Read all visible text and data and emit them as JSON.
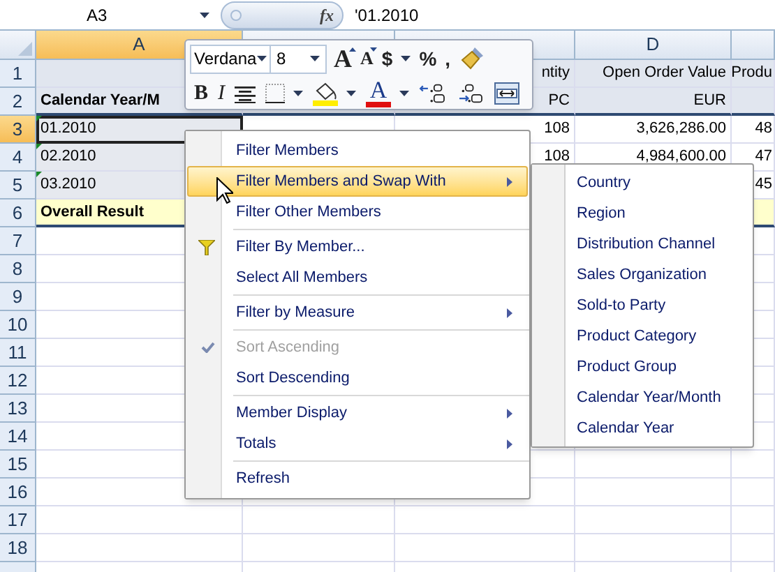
{
  "formula_bar": {
    "cell_ref": "A3",
    "function_label": "fx",
    "formula": "'01.2010"
  },
  "columns": [
    {
      "label": "A",
      "selected": true
    },
    {
      "selected": false
    },
    {
      "selected": false
    },
    {
      "label": "D",
      "selected": false
    },
    {
      "selected": false
    }
  ],
  "rows": [
    {
      "number": "1",
      "kind": "header",
      "selected": false,
      "cells": [
        null,
        null,
        "ntity",
        "Open Order Value",
        "Produ"
      ]
    },
    {
      "number": "2",
      "kind": "header",
      "selected": false,
      "cells": [
        "Calendar Year/M",
        null,
        "PC",
        "EUR",
        null
      ]
    },
    {
      "number": "3",
      "kind": "data",
      "selected": true,
      "cells": [
        "01.2010",
        null,
        "108",
        "3,626,286.00",
        "48"
      ]
    },
    {
      "number": "4",
      "kind": "data",
      "selected": false,
      "cells": [
        "02.2010",
        null,
        "108",
        "4,984,600.00",
        "47"
      ]
    },
    {
      "number": "5",
      "kind": "data",
      "selected": false,
      "cells": [
        "03.2010",
        null,
        null,
        null,
        "45"
      ]
    },
    {
      "number": "6",
      "kind": "total",
      "selected": false,
      "cells": [
        "Overall Result",
        null,
        null,
        null,
        null
      ]
    },
    {
      "number": "7",
      "kind": "empty",
      "selected": false
    },
    {
      "number": "8",
      "kind": "empty",
      "selected": false
    },
    {
      "number": "9",
      "kind": "empty",
      "selected": false
    },
    {
      "number": "10",
      "kind": "empty",
      "selected": false
    },
    {
      "number": "11",
      "kind": "empty",
      "selected": false
    },
    {
      "number": "12",
      "kind": "empty",
      "selected": false
    },
    {
      "number": "13",
      "kind": "empty",
      "selected": false
    },
    {
      "number": "14",
      "kind": "empty",
      "selected": false
    },
    {
      "number": "15",
      "kind": "empty",
      "selected": false
    },
    {
      "number": "16",
      "kind": "empty",
      "selected": false
    },
    {
      "number": "17",
      "kind": "empty",
      "selected": false
    },
    {
      "number": "18",
      "kind": "empty",
      "selected": false
    }
  ],
  "mini_toolbar": {
    "font": "Verdana",
    "size": "8",
    "row_1": [
      {
        "kind": "grow",
        "label": "A"
      },
      {
        "kind": "shrink",
        "label": "A"
      },
      {
        "kind": "currency",
        "label": "$"
      },
      {
        "kind": "percent",
        "label": "%"
      },
      {
        "kind": "comma",
        "label": ","
      },
      {
        "kind": "painter"
      }
    ],
    "row_2": [
      {
        "kind": "bold",
        "label": "B"
      },
      {
        "kind": "italic",
        "label": "I"
      },
      {
        "kind": "center"
      },
      {
        "kind": "borders"
      },
      {
        "kind": "fill"
      },
      {
        "kind": "font_color",
        "label": "A"
      },
      {
        "kind": "inc_decimal"
      },
      {
        "kind": "dec_decimal"
      },
      {
        "kind": "merge"
      }
    ]
  },
  "context_menu": [
    {
      "kind": "item",
      "label": "Filter Members",
      "selected": false,
      "submenu": false,
      "disabled": false,
      "checked": false
    },
    {
      "kind": "item",
      "label": "Filter Members and Swap With",
      "selected": true,
      "submenu": true,
      "disabled": false,
      "checked": false
    },
    {
      "kind": "item",
      "label": "Filter Other Members",
      "selected": false,
      "submenu": false,
      "disabled": false,
      "checked": false
    },
    {
      "kind": "separator"
    },
    {
      "kind": "filter_item",
      "label": "Filter By Member...",
      "selected": false,
      "submenu": false,
      "disabled": false,
      "checked": false
    },
    {
      "kind": "item",
      "label": "Select All Members",
      "selected": false,
      "submenu": false,
      "disabled": false,
      "checked": false
    },
    {
      "kind": "separator"
    },
    {
      "kind": "item",
      "label": "Filter by Measure",
      "selected": false,
      "submenu": true,
      "disabled": false,
      "checked": false
    },
    {
      "kind": "separator"
    },
    {
      "kind": "item",
      "label": "Sort Ascending",
      "selected": false,
      "submenu": false,
      "disabled": true,
      "checked": true
    },
    {
      "kind": "item",
      "label": "Sort Descending",
      "selected": false,
      "submenu": false,
      "disabled": false,
      "checked": false
    },
    {
      "kind": "separator"
    },
    {
      "kind": "item",
      "label": "Member Display",
      "selected": false,
      "submenu": true,
      "disabled": false,
      "checked": false
    },
    {
      "kind": "item",
      "label": "Totals",
      "selected": false,
      "submenu": true,
      "disabled": false,
      "checked": false
    },
    {
      "kind": "separator"
    },
    {
      "kind": "item",
      "label": "Refresh",
      "selected": false,
      "submenu": false,
      "disabled": false,
      "checked": false
    }
  ],
  "submenu": [
    "Country",
    "Region",
    "Distribution Channel",
    "Sales Organization",
    "Sold-to Party",
    "Product Category",
    "Product Group",
    "Calendar Year/Month",
    "Calendar Year"
  ]
}
